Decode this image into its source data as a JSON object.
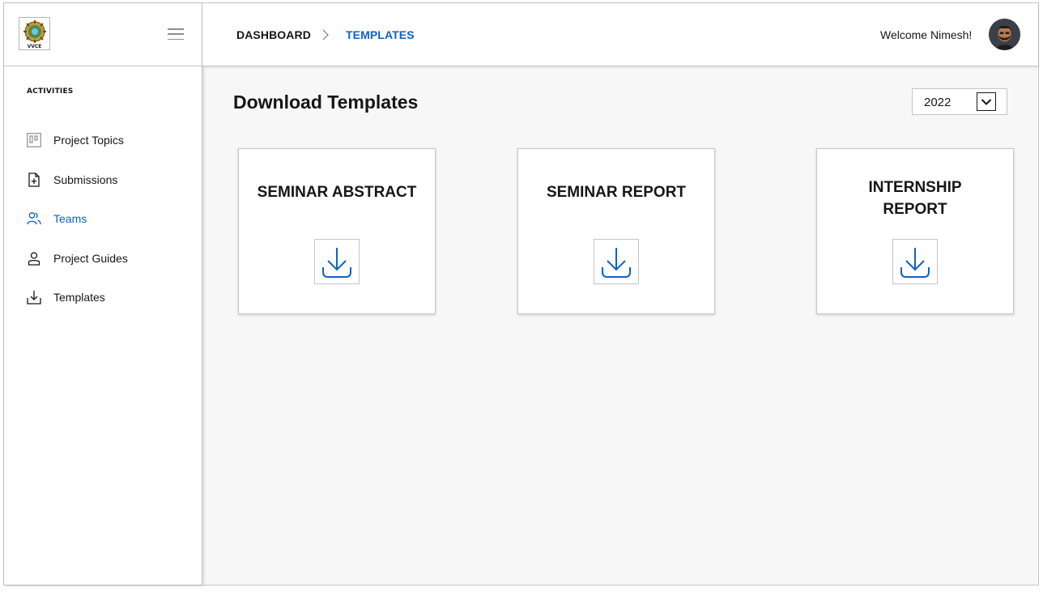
{
  "sidebar": {
    "logo_text": "VVCE",
    "section_title": "ACTIVITIES",
    "items": [
      {
        "label": "Project Topics",
        "icon": "kanban-icon"
      },
      {
        "label": "Submissions",
        "icon": "file-add-icon"
      },
      {
        "label": "Teams",
        "icon": "group-icon",
        "active": true
      },
      {
        "label": "Project Guides",
        "icon": "user-icon"
      },
      {
        "label": "Templates",
        "icon": "download-icon"
      }
    ]
  },
  "header": {
    "breadcrumb": [
      "DASHBOARD",
      "TEMPLATES"
    ],
    "welcome": "Welcome Nimesh!"
  },
  "main": {
    "title": "Download Templates",
    "year": "2022",
    "cards": [
      {
        "title": "SEMINAR ABSTRACT"
      },
      {
        "title": "SEMINAR REPORT"
      },
      {
        "title": "INTERNSHIP REPORT"
      }
    ]
  },
  "colors": {
    "accent": "#0f62c4",
    "border": "#c6c6c6",
    "background": "#f7f7f7"
  }
}
